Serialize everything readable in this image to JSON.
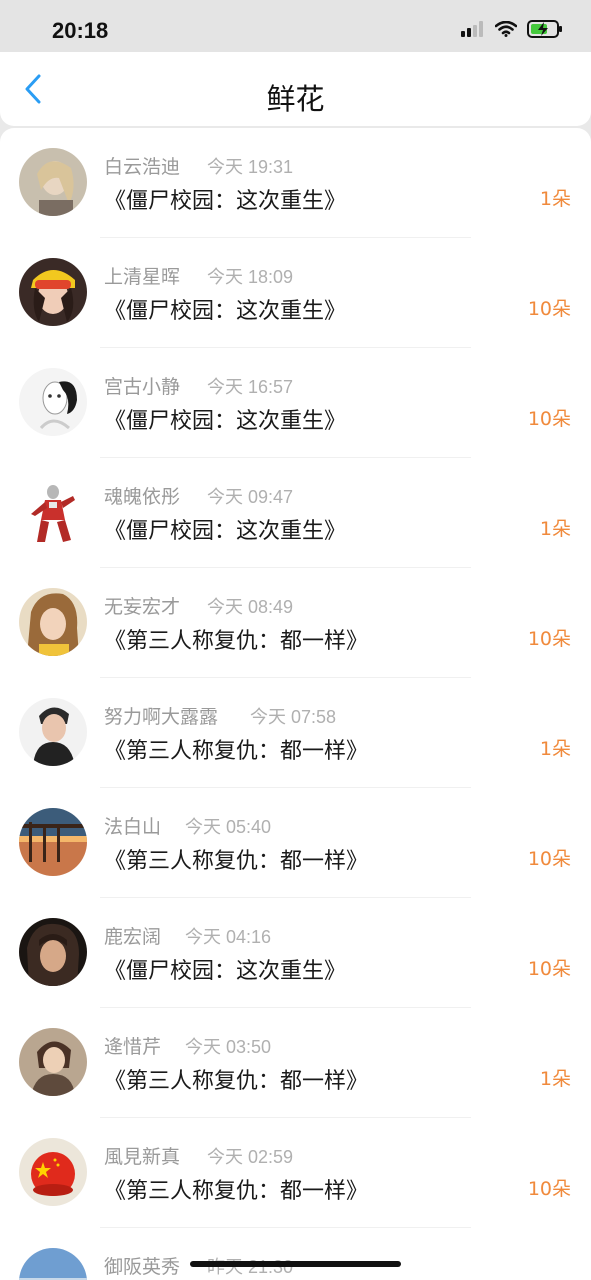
{
  "status_bar": {
    "time": "20:18"
  },
  "nav": {
    "title": "鲜花"
  },
  "items": [
    {
      "name": "白云浩迪",
      "time": "今天 19:31",
      "book": "《僵尸校园：这次重生》",
      "count": "1朵"
    },
    {
      "name": "上清星晖",
      "time": "今天 18:09",
      "book": "《僵尸校园：这次重生》",
      "count": "10朵"
    },
    {
      "name": "宫古小静",
      "time": "今天 16:57",
      "book": "《僵尸校园：这次重生》",
      "count": "10朵"
    },
    {
      "name": "魂魄依彤",
      "time": "今天 09:47",
      "book": "《僵尸校园：这次重生》",
      "count": "1朵"
    },
    {
      "name": "无妄宏才",
      "time": "今天 08:49",
      "book": "《第三人称复仇：都一样》",
      "count": "10朵"
    },
    {
      "name": "努力啊大露露",
      "time": "今天 07:58",
      "book": "《第三人称复仇：都一样》",
      "count": "1朵"
    },
    {
      "name": "法白山",
      "time": "今天 05:40",
      "book": "《第三人称复仇：都一样》",
      "count": "10朵"
    },
    {
      "name": "鹿宏阔",
      "time": "今天 04:16",
      "book": "《僵尸校园：这次重生》",
      "count": "10朵"
    },
    {
      "name": "逄惜芹",
      "time": "今天 03:50",
      "book": "《第三人称复仇：都一样》",
      "count": "1朵"
    },
    {
      "name": "風見新真",
      "time": "今天 02:59",
      "book": "《第三人称复仇：都一样》",
      "count": "10朵"
    },
    {
      "name": "御阪英秀",
      "time": "昨天 21:30",
      "book": "",
      "count": ""
    }
  ],
  "colors": {
    "accent": "#2a9df4",
    "count": "#f08a3c"
  },
  "icons": {
    "back": "chevron-left-icon",
    "signal": "signal-icon",
    "wifi": "wifi-icon",
    "battery": "battery-charging-icon"
  }
}
